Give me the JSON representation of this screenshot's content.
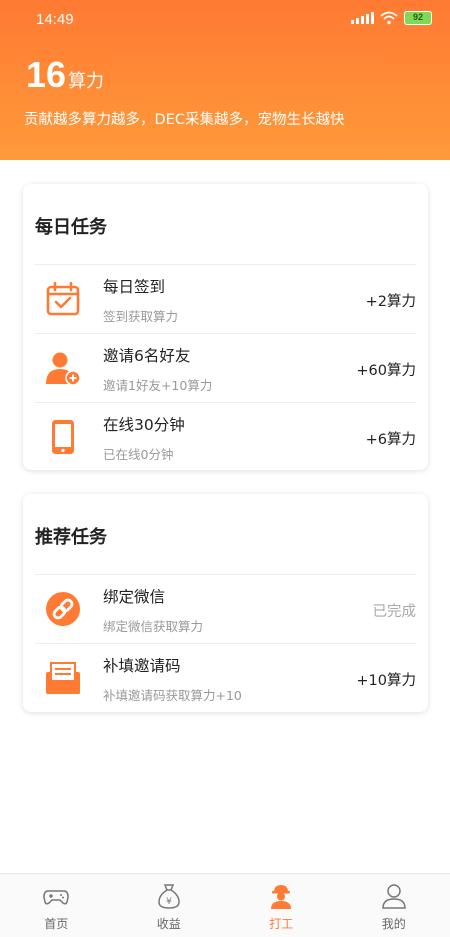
{
  "status_bar": {
    "time": "14:49",
    "battery": "92"
  },
  "header": {
    "power_value": "16",
    "power_unit": "算力",
    "subtitle": "贡献越多算力越多，DEC采集越多，宠物生长越快"
  },
  "daily_tasks": {
    "title": "每日任务",
    "items": [
      {
        "name": "每日签到",
        "desc": "签到获取算力",
        "reward": "+2算力",
        "icon": "calendar-check-icon"
      },
      {
        "name": "邀请6名好友",
        "desc": "邀请1好友+10算力",
        "reward": "+60算力",
        "icon": "add-user-icon"
      },
      {
        "name": "在线30分钟",
        "desc": "已在线0分钟",
        "reward": "+6算力",
        "icon": "phone-icon"
      }
    ]
  },
  "recommended_tasks": {
    "title": "推荐任务",
    "items": [
      {
        "name": "绑定微信",
        "desc": "绑定微信获取算力",
        "reward": "已完成",
        "icon": "link-icon"
      },
      {
        "name": "补填邀请码",
        "desc": "补填邀请码获取算力+10",
        "reward": "+10算力",
        "icon": "invite-code-icon"
      }
    ]
  },
  "tabbar": {
    "tabs": [
      {
        "label": "首页",
        "icon": "gamepad-icon"
      },
      {
        "label": "收益",
        "icon": "money-bag-icon"
      },
      {
        "label": "打工",
        "icon": "worker-icon",
        "active": true
      },
      {
        "label": "我的",
        "icon": "profile-icon"
      }
    ]
  },
  "colors": {
    "accent": "#ff7a33",
    "accent_light": "#ff9a3a"
  }
}
